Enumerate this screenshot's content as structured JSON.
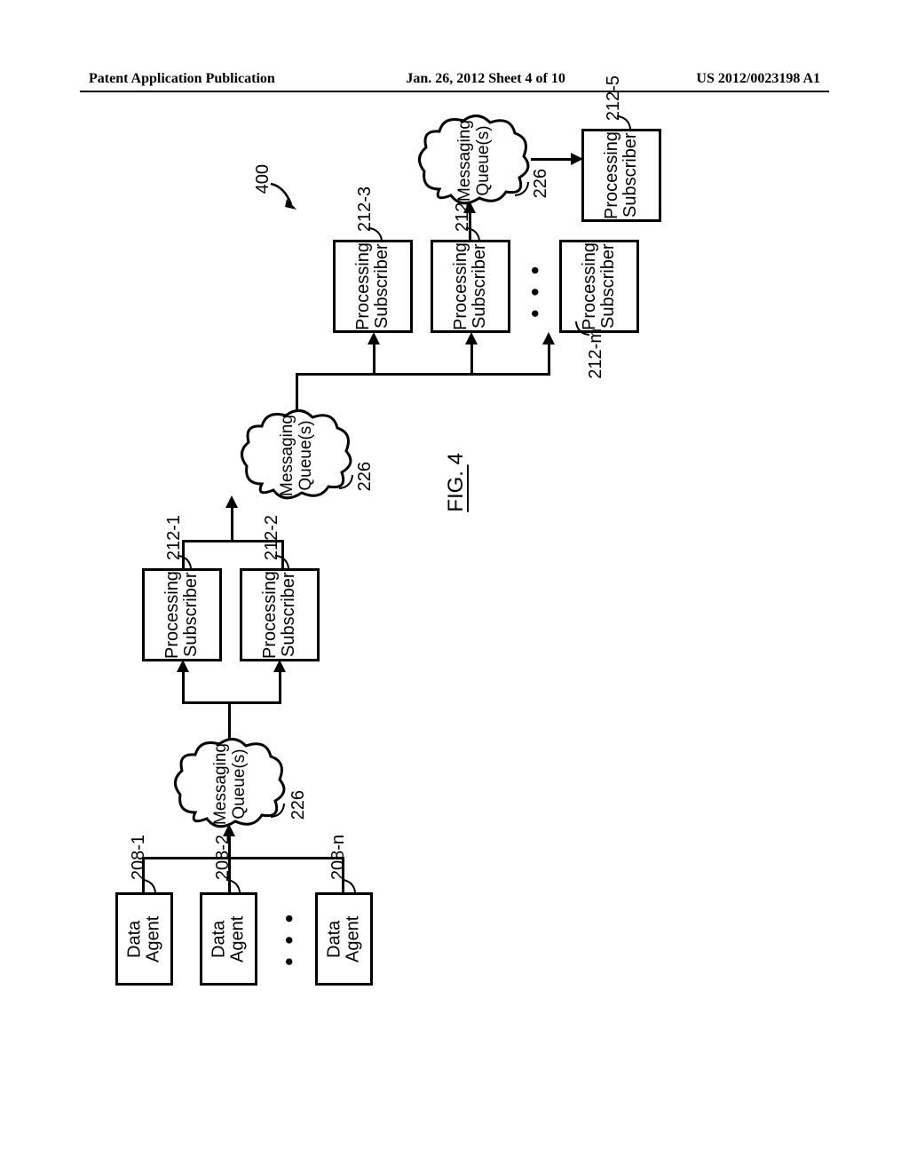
{
  "header": {
    "left": "Patent Application Publication",
    "center": "Jan. 26, 2012  Sheet 4 of 10",
    "right": "US 2012/0023198 A1"
  },
  "figure": {
    "system_ref": "400",
    "fig_label_prefix": "FIG. ",
    "fig_label_num": "4",
    "data_agent_label": "Data\nAgent",
    "processing_subscriber_label": "Processing\nSubscriber",
    "messaging_queue_label": "Messaging\nQueue(s)",
    "queue_ref": "226",
    "refs": {
      "da1": "208-1",
      "da2": "208-2",
      "dan": "208-n",
      "ps1": "212-1",
      "ps2": "212-2",
      "ps3": "212-3",
      "ps4": "212-4",
      "psm": "212-m",
      "ps5": "212-5"
    },
    "ellipsis": "• • •"
  }
}
